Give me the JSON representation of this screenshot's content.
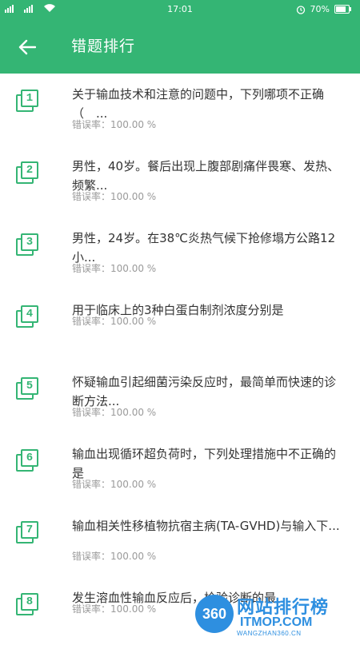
{
  "status_bar": {
    "time": "17:01",
    "battery": "70%"
  },
  "app_bar": {
    "title": "错题排行"
  },
  "questions": [
    {
      "rank": "1",
      "text": "关于输血技术和注意的问题中，下列哪项不正确（　...",
      "rate": "错误率：100.00 %"
    },
    {
      "rank": "2",
      "text": "男性，40岁。餐后出现上腹部剧痛伴畏寒、发热、频繁...",
      "rate": "错误率：100.00 %"
    },
    {
      "rank": "3",
      "text": "男性，24岁。在38℃炎热气候下抢修塌方公路12小...",
      "rate": "错误率：100.00 %"
    },
    {
      "rank": "4",
      "text": "用于临床上的3种白蛋白制剂浓度分别是",
      "rate": "错误率：100.00 %"
    },
    {
      "rank": "5",
      "text": "怀疑输血引起细菌污染反应时，最简单而快速的诊断方法...",
      "rate": "错误率：100.00 %"
    },
    {
      "rank": "6",
      "text": "输血出现循环超负荷时，下列处理措施中不正确的是",
      "rate": "错误率：100.00 %"
    },
    {
      "rank": "7",
      "text": "输血相关性移植物抗宿主病(TA-GVHD)与输入下...",
      "rate": "错误率：100.00 %"
    },
    {
      "rank": "8",
      "text": "发生溶血性输血反应后，检验诊断的最",
      "rate": "错误率：100.00 %"
    }
  ],
  "watermark": {
    "logo": "360",
    "title": "网站排行榜",
    "sub": "ITMOP.COM",
    "url": "WANGZHAN360.CN"
  },
  "colors": {
    "primary": "#34b574",
    "watermark": "#2e8fe0"
  }
}
